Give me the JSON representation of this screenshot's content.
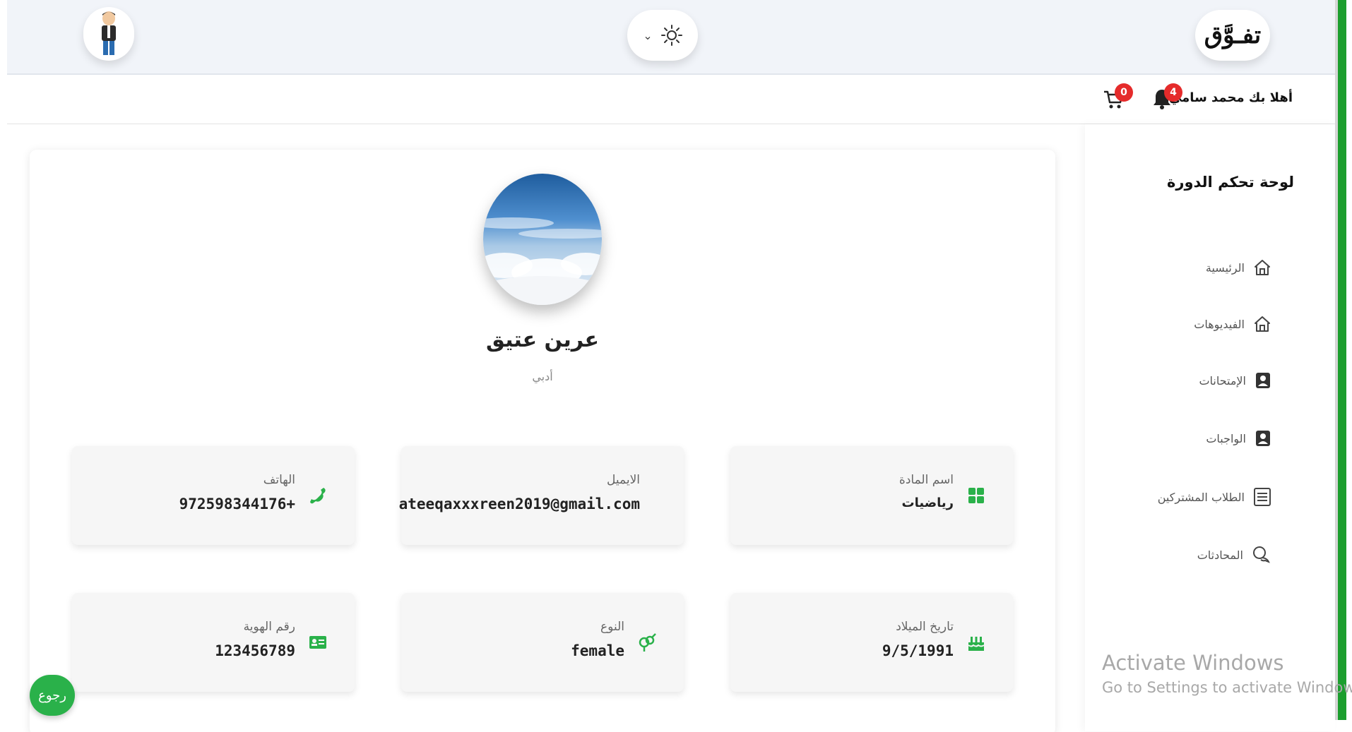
{
  "header": {
    "logo_text": "تفـوَّق",
    "theme_icon": "sun-icon",
    "theme_dropdown_icon": "chevron-down-icon",
    "user_avatar_icon": "avatar-icon"
  },
  "subbar": {
    "welcome": "أهلا بك محمد سامي",
    "notification_count": "4",
    "cart_count": "0"
  },
  "sidebar": {
    "title": "لوحة تحكم الدورة",
    "items": [
      {
        "label": "الرئيسية",
        "icon": "home-icon"
      },
      {
        "label": "الفيديوهات",
        "icon": "home-icon"
      },
      {
        "label": "الإمتحانات",
        "icon": "person-badge-icon"
      },
      {
        "label": "الواجبات",
        "icon": "person-badge-icon"
      },
      {
        "label": "الطلاب المشتركين",
        "icon": "list-icon"
      },
      {
        "label": "المحادثات",
        "icon": "chat-icon"
      }
    ]
  },
  "profile": {
    "name": "عرين عتيق",
    "subtitle": "أدبي"
  },
  "info_cards": [
    {
      "label": "اسم المادة",
      "value": "رياضيات",
      "icon": "grid-icon"
    },
    {
      "label": "الايميل",
      "value": "ateeqaxxxreen2019@gmail.com",
      "icon": ""
    },
    {
      "label": "الهاتف",
      "value": "972598344176+",
      "icon": "phone-icon"
    },
    {
      "label": "تاريخ الميلاد",
      "value": "9/5/1991",
      "icon": "cake-icon"
    },
    {
      "label": "النوع",
      "value": "female",
      "icon": "gender-icon"
    },
    {
      "label": "رقم الهوية",
      "value": "123456789",
      "icon": "id-card-icon"
    }
  ],
  "back_button": "رجوع",
  "watermark": {
    "line1": "Activate Windows",
    "line2": "Go to Settings to activate Windows."
  },
  "colors": {
    "accent_green": "#2ab14a",
    "badge_red": "#e52b2b",
    "edge_green": "#1c9e2e"
  }
}
